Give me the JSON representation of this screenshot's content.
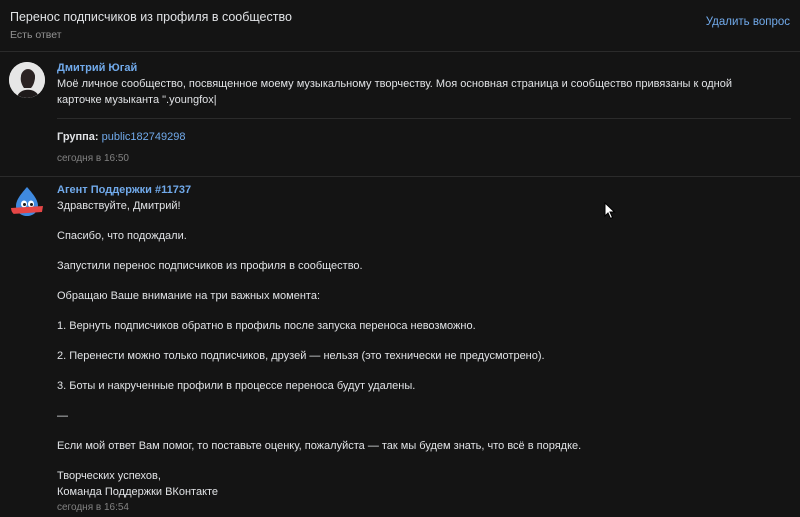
{
  "header": {
    "title": "Перенос подписчиков из профиля в сообщество",
    "subtitle": "Есть ответ",
    "delete_label": "Удалить вопрос"
  },
  "message1": {
    "author": "Дмитрий Югай",
    "line1": "Моё личное сообщество, посвященное моему музыкальному творчеству. Моя основная страница и сообщество привязаны к одной",
    "line2": "карточке музыканта \".youngfox|",
    "group_label": "Группа:",
    "group_value": "public182749298",
    "time": "сегодня в 16:50"
  },
  "message2": {
    "author": "Агент Поддержки #11737",
    "p1": "Здравствуйте, Дмитрий!",
    "p2": "Спасибо, что подождали.",
    "p3": "Запустили перенос подписчиков из профиля в сообщество.",
    "p4": "Обращаю Ваше внимание на три важных момента:",
    "p5": "1. Вернуть подписчиков обратно в профиль после запуска переноса невозможно.",
    "p6": "2. Перенести можно только подписчиков, друзей — нельзя (это технически не предусмотрено).",
    "p7": "3. Боты и накрученные профили в процессе переноса будут удалены.",
    "p8": "—",
    "p9": "Если мой ответ Вам помог, то поставьте оценку, пожалуйста — так мы будем знать, что всё в порядке.",
    "p10": "Творческих успехов,",
    "p11": "Команда Поддержки ВКонтакте",
    "time": "сегодня в 16:54"
  }
}
